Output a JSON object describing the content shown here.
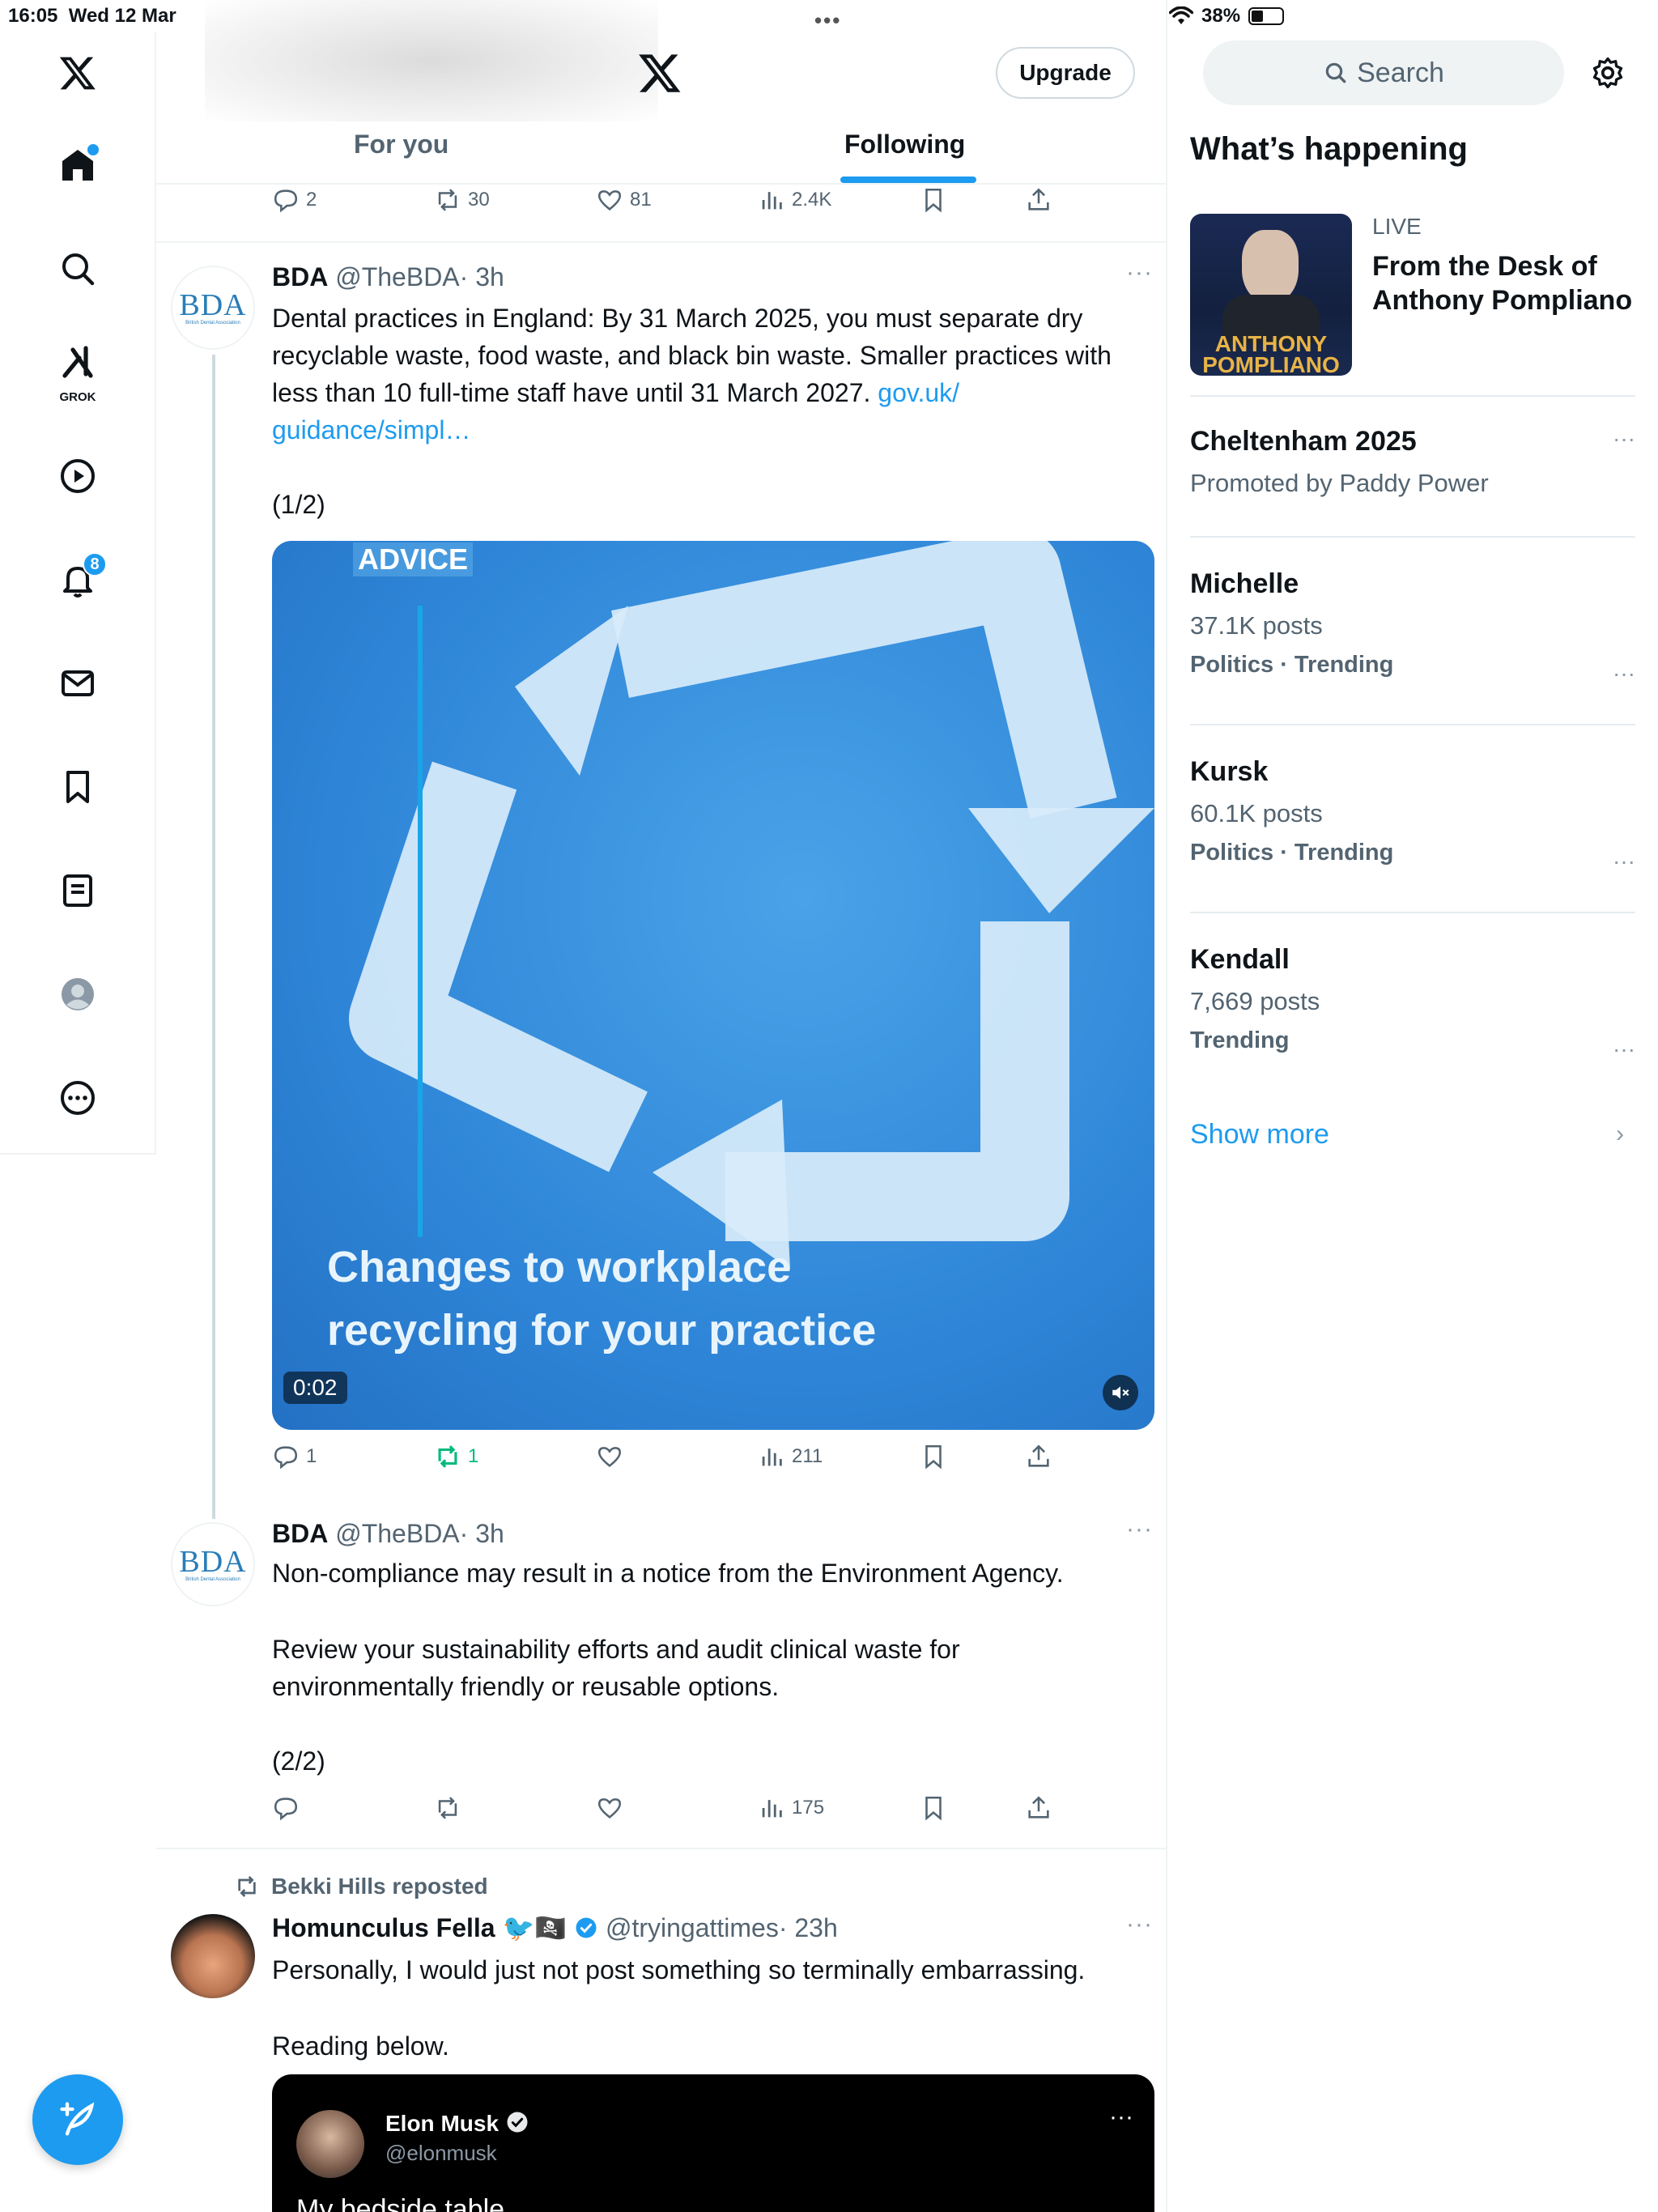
{
  "status_bar": {
    "time": "16:05",
    "date": "Wed 12 Mar",
    "handle": "•••",
    "battery": "38%"
  },
  "sidebar": {
    "grok_label": "GROK",
    "notifications_badge": "8"
  },
  "header": {
    "upgrade_label": "Upgrade",
    "tabs": [
      {
        "label": "For you"
      },
      {
        "label": "Following"
      }
    ]
  },
  "feed": {
    "top_actions": {
      "replies": "2",
      "reposts": "30",
      "likes": "81",
      "views": "2.4K"
    },
    "post1": {
      "avatar_text": "BDA",
      "avatar_subtext": "British Dental Association",
      "name": "BDA",
      "handle": "@TheBDA",
      "time": "· 3h",
      "more": "···",
      "text": "Dental practices in England: By 31 March 2025, you must separate dry recyclable waste, food waste, and black bin waste. Smaller practices with less than 10 full-time staff have until 31 March 2027.",
      "link": "gov.uk/ guidance/simpl…",
      "counter": "(1/2)",
      "video": {
        "tag": "ADVICE",
        "overlay_line1": "Changes to workplace",
        "overlay_line2": "recycling for your practice",
        "timecode": "0:02"
      },
      "actions": {
        "replies": "1",
        "reposts": "1",
        "likes": "",
        "views": "211"
      }
    },
    "post2": {
      "avatar_text": "BDA",
      "avatar_subtext": "British Dental Association",
      "name": "BDA",
      "handle": "@TheBDA",
      "time": "· 3h",
      "more": "···",
      "text1": "Non-compliance may result in a notice from the Environment Agency.",
      "text2": "Review your sustainability efforts and audit clinical waste for environmentally friendly or reusable options.",
      "counter": "(2/2)",
      "actions": {
        "replies": "",
        "reposts": "",
        "likes": "",
        "views": "175"
      }
    },
    "post3": {
      "repost_label": "Bekki Hills reposted",
      "name": "Homunculus Fella",
      "emoji": "🐦🏴‍☠️",
      "handle": "@tryingattimes",
      "time": "· 23h",
      "more": "···",
      "text1": "Personally, I would just not post something so terminally embarrassing.",
      "text2": "Reading below.",
      "quote": {
        "name": "Elon Musk",
        "handle": "@elonmusk",
        "text": "My bedside table",
        "more": "···"
      }
    }
  },
  "right_sidebar": {
    "search_placeholder": "Search",
    "section_title": "What’s happening",
    "live": {
      "label": "LIVE",
      "title": "From the Desk of Anthony Pompliano",
      "thumb_text": "ANTHONY POMPLIANO"
    },
    "promoted": {
      "name": "Cheltenham 2025",
      "meta": "Promoted by Paddy Power"
    },
    "trends": [
      {
        "name": "Michelle",
        "posts": "37.1K posts",
        "meta": "Politics · Trending"
      },
      {
        "name": "Kursk",
        "posts": "60.1K posts",
        "meta": "Politics · Trending"
      },
      {
        "name": "Kendall",
        "posts": "7,669 posts",
        "meta": "Trending"
      }
    ],
    "show_more": "Show more"
  },
  "colors": {
    "accent": "#1d9bf0",
    "text": "#0f1419",
    "secondary_text": "#536471",
    "repost_green": "#00ba7c",
    "border": "#eff3f4"
  }
}
